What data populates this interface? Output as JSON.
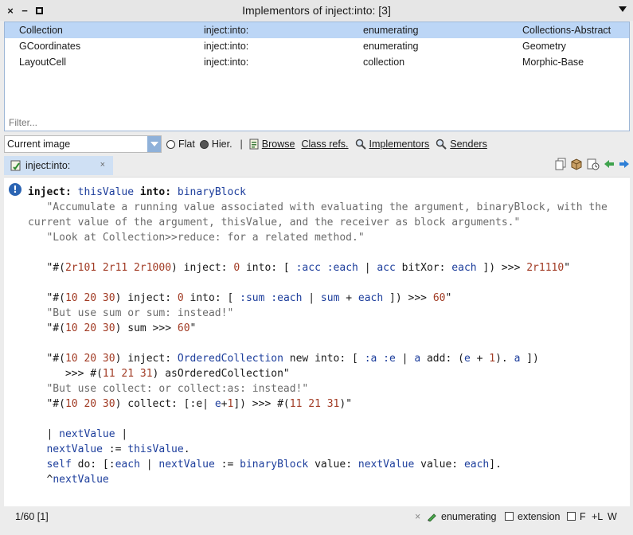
{
  "window": {
    "title": "Implementors of inject:into: [3]",
    "close_glyph": "×",
    "minimize_glyph": "−"
  },
  "results": {
    "rows": [
      {
        "name": "Collection",
        "selector": "inject:into:",
        "protocol": "enumerating",
        "package": "Collections-Abstract",
        "selected": true
      },
      {
        "name": "GCoordinates",
        "selector": "inject:into:",
        "protocol": "enumerating",
        "package": "Geometry",
        "selected": false
      },
      {
        "name": "LayoutCell",
        "selector": "inject:into:",
        "protocol": "collection",
        "package": "Morphic-Base",
        "selected": false
      }
    ],
    "filter_placeholder": "Filter..."
  },
  "toolbar": {
    "scope_value": "Current image",
    "flat_label": "Flat",
    "hier_label": "Hier.",
    "hier_selected": true,
    "separator": "|",
    "browse_label": "Browse",
    "class_refs_label": "Class refs.",
    "implementors_label": "Implementors",
    "senders_label": "Senders"
  },
  "tab": {
    "label": "inject:into:",
    "close_glyph": "×"
  },
  "editor": {
    "gutter_icon": "!",
    "lines": [
      [
        {
          "t": "inject:",
          "c": "sel-kw"
        },
        {
          "t": " "
        },
        {
          "t": "thisValue",
          "c": "arg"
        },
        {
          "t": " "
        },
        {
          "t": "into:",
          "c": "sel-kw"
        },
        {
          "t": " "
        },
        {
          "t": "binaryBlock",
          "c": "arg"
        }
      ],
      [
        {
          "t": "   \"Accumulate a running value associated with evaluating the argument, binaryBlock, with the",
          "c": "cmt"
        }
      ],
      [
        {
          "t": "current value of the argument, thisValue, and the receiver as block arguments.\"",
          "c": "cmt"
        }
      ],
      [
        {
          "t": "   \"Look at Collection>>reduce: for a related method.\"",
          "c": "cmt"
        }
      ],
      [],
      [
        {
          "t": "   \"#(",
          "c": ""
        },
        {
          "t": "2r101 2r11 2r1000",
          "c": "num"
        },
        {
          "t": ") inject: "
        },
        {
          "t": "0",
          "c": "num"
        },
        {
          "t": " into: [ "
        },
        {
          "t": ":acc :each",
          "c": "arg"
        },
        {
          "t": " | "
        },
        {
          "t": "acc",
          "c": "arg"
        },
        {
          "t": " bitXor: "
        },
        {
          "t": "each",
          "c": "arg"
        },
        {
          "t": " ]) >>> "
        },
        {
          "t": "2r1110",
          "c": "num"
        },
        {
          "t": "\""
        }
      ],
      [],
      [
        {
          "t": "   \"#(",
          "c": ""
        },
        {
          "t": "10 20 30",
          "c": "num"
        },
        {
          "t": ") inject: "
        },
        {
          "t": "0",
          "c": "num"
        },
        {
          "t": " into: [ "
        },
        {
          "t": ":sum :each",
          "c": "arg"
        },
        {
          "t": " | "
        },
        {
          "t": "sum",
          "c": "arg"
        },
        {
          "t": " + "
        },
        {
          "t": "each",
          "c": "arg"
        },
        {
          "t": " ]) >>> "
        },
        {
          "t": "60",
          "c": "num"
        },
        {
          "t": "\""
        }
      ],
      [
        {
          "t": "   \"But use sum or sum: instead!\"",
          "c": "cmt"
        }
      ],
      [
        {
          "t": "   \"#(",
          "c": ""
        },
        {
          "t": "10 20 30",
          "c": "num"
        },
        {
          "t": ") sum >>> "
        },
        {
          "t": "60",
          "c": "num"
        },
        {
          "t": "\""
        }
      ],
      [],
      [
        {
          "t": "   \"#(",
          "c": ""
        },
        {
          "t": "10 20 30",
          "c": "num"
        },
        {
          "t": ") inject: "
        },
        {
          "t": "OrderedCollection",
          "c": "cls"
        },
        {
          "t": " new into: [ "
        },
        {
          "t": ":a :e",
          "c": "arg"
        },
        {
          "t": " | "
        },
        {
          "t": "a",
          "c": "arg"
        },
        {
          "t": " add: ("
        },
        {
          "t": "e",
          "c": "arg"
        },
        {
          "t": " + "
        },
        {
          "t": "1",
          "c": "num"
        },
        {
          "t": "). "
        },
        {
          "t": "a",
          "c": "arg"
        },
        {
          "t": " ])"
        }
      ],
      [
        {
          "t": "      >>> #("
        },
        {
          "t": "11 21 31",
          "c": "num"
        },
        {
          "t": ") asOrderedCollection\""
        }
      ],
      [
        {
          "t": "   \"But use collect: or collect:as: instead!\"",
          "c": "cmt"
        }
      ],
      [
        {
          "t": "   \"#(",
          "c": ""
        },
        {
          "t": "10 20 30",
          "c": "num"
        },
        {
          "t": ") collect: [:e| "
        },
        {
          "t": "e",
          "c": "arg"
        },
        {
          "t": "+"
        },
        {
          "t": "1",
          "c": "num"
        },
        {
          "t": "]) >>> #("
        },
        {
          "t": "11 21 31",
          "c": "num"
        },
        {
          "t": ")\""
        }
      ],
      [],
      [
        {
          "t": "   | "
        },
        {
          "t": "nextValue",
          "c": "arg"
        },
        {
          "t": " |"
        }
      ],
      [
        {
          "t": "   "
        },
        {
          "t": "nextValue",
          "c": "arg"
        },
        {
          "t": " := "
        },
        {
          "t": "thisValue",
          "c": "arg"
        },
        {
          "t": "."
        }
      ],
      [
        {
          "t": "   "
        },
        {
          "t": "self",
          "c": "kw"
        },
        {
          "t": " do: [:"
        },
        {
          "t": "each",
          "c": "arg"
        },
        {
          "t": " | "
        },
        {
          "t": "nextValue",
          "c": "arg"
        },
        {
          "t": " := "
        },
        {
          "t": "binaryBlock",
          "c": "arg"
        },
        {
          "t": " value: "
        },
        {
          "t": "nextValue",
          "c": "arg"
        },
        {
          "t": " value: "
        },
        {
          "t": "each",
          "c": "arg"
        },
        {
          "t": "]."
        }
      ],
      [
        {
          "t": "   ^"
        },
        {
          "t": "nextValue",
          "c": "arg"
        }
      ]
    ]
  },
  "status": {
    "position": "1/60 [1]",
    "clear_glyph": "×",
    "category": "enumerating",
    "extension_label": "extension",
    "f_label": "F",
    "l_label": "+L",
    "w_label": "W"
  }
}
